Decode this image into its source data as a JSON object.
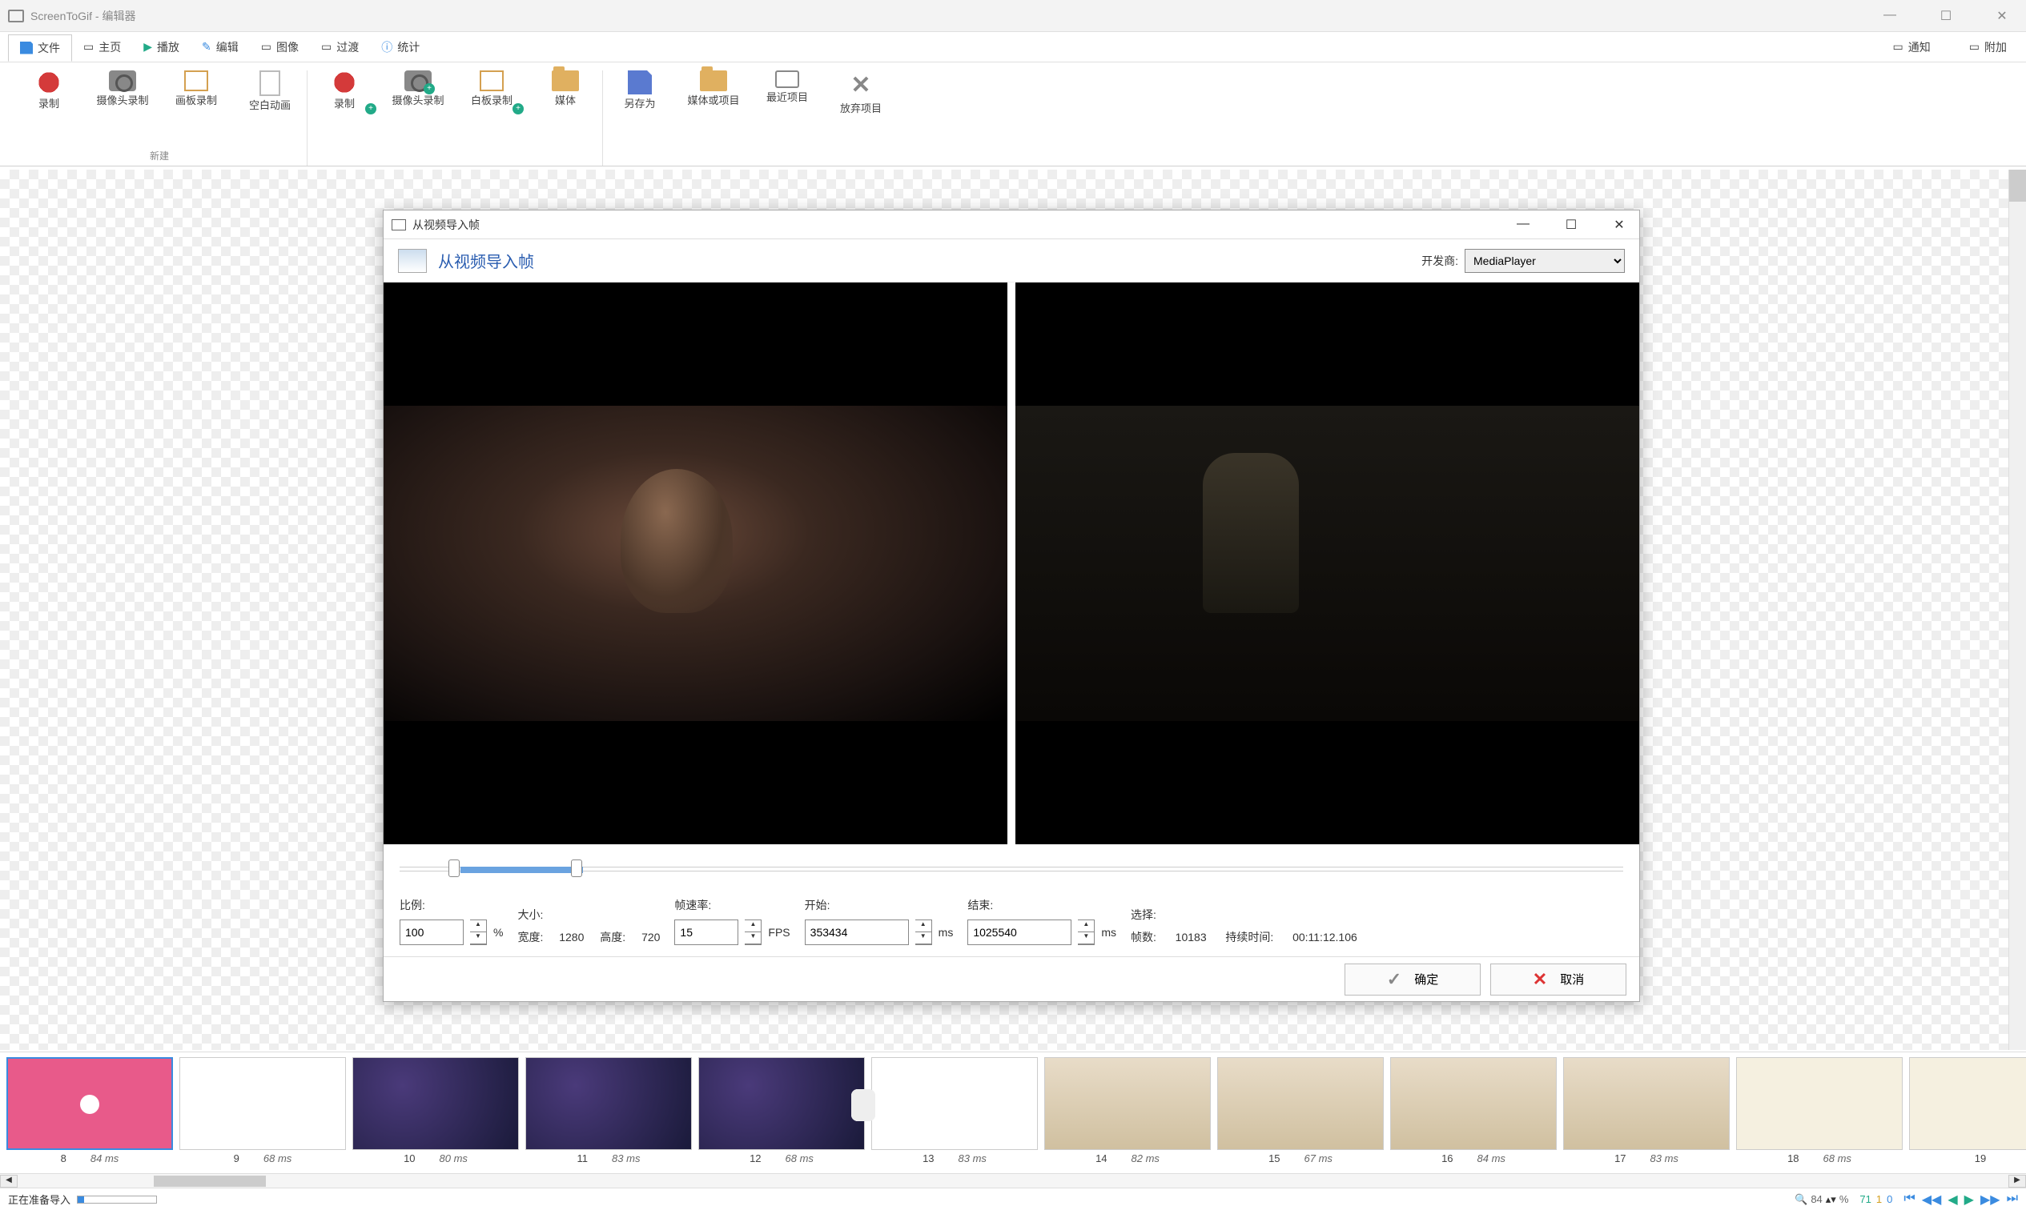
{
  "app": {
    "title": "ScreenToGif - 编辑器"
  },
  "tabs": {
    "file": "文件",
    "home": "主页",
    "play": "播放",
    "edit": "编辑",
    "image": "图像",
    "transition": "过渡",
    "stats": "统计",
    "notify": "通知",
    "attach": "附加"
  },
  "ribbon": {
    "group_new": "新建",
    "record": "录制",
    "cam_record": "摄像头录制",
    "board_record": "画板录制",
    "blank_anim": "空白动画",
    "record2": "录制",
    "cam_record2": "摄像头录制",
    "white_record": "白板录制",
    "media": "媒体",
    "save_as": "另存为",
    "media_project": "媒体或项目",
    "recent": "最近项目",
    "discard": "放弃项目"
  },
  "dialog": {
    "title": "从视频导入帧",
    "header": "从视频导入帧",
    "developer_label": "开发商:",
    "developer_value": "MediaPlayer",
    "labels": {
      "scale": "比例:",
      "size": "大小:",
      "fps": "帧速率:",
      "start": "开始:",
      "end": "结束:",
      "selection": "选择:",
      "width": "宽度:",
      "height": "高度:",
      "frames": "帧数:",
      "duration": "持续时间:"
    },
    "units": {
      "percent": "%",
      "fps": "FPS",
      "ms": "ms"
    },
    "values": {
      "scale": "100",
      "width": "1280",
      "height": "720",
      "fps": "15",
      "start": "353434",
      "end": "1025540",
      "frames": "10183",
      "duration": "00:11:12.106"
    },
    "ok": "确定",
    "cancel": "取消"
  },
  "frames": [
    {
      "n": "8",
      "d": "84 ms",
      "cls": "pink",
      "sel": true
    },
    {
      "n": "9",
      "d": "68 ms",
      "cls": "tw"
    },
    {
      "n": "10",
      "d": "80 ms",
      "cls": "space"
    },
    {
      "n": "11",
      "d": "83 ms",
      "cls": "space"
    },
    {
      "n": "12",
      "d": "68 ms",
      "cls": "space"
    },
    {
      "n": "13",
      "d": "83 ms",
      "cls": "doc"
    },
    {
      "n": "14",
      "d": "82 ms",
      "cls": "room"
    },
    {
      "n": "15",
      "d": "67 ms",
      "cls": "room"
    },
    {
      "n": "16",
      "d": "84 ms",
      "cls": "room"
    },
    {
      "n": "17",
      "d": "83 ms",
      "cls": "room"
    },
    {
      "n": "18",
      "d": "68 ms",
      "cls": "notes"
    },
    {
      "n": "19",
      "d": "",
      "cls": "notes"
    }
  ],
  "status": {
    "text": "正在准备导入",
    "zoom": "84",
    "zoom_unit": "%",
    "sel_total": "71",
    "sel_a": "1",
    "sel_b": "0"
  }
}
